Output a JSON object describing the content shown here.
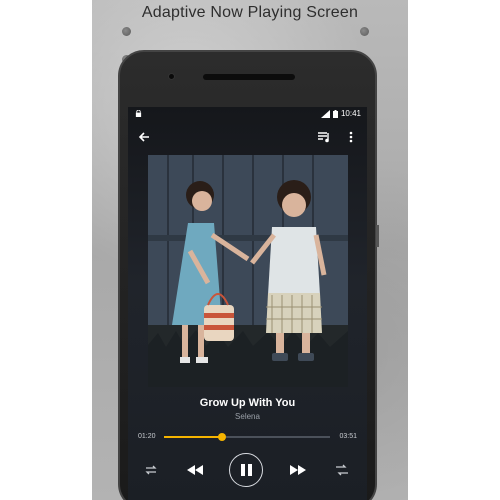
{
  "headline": "Adaptive Now Playing Screen",
  "status_bar": {
    "time": "10:41"
  },
  "icons": {
    "back": "arrow-back-icon",
    "queue": "queue-music-icon",
    "menu": "more-vert-icon",
    "repeat": "repeat-icon",
    "previous": "skip-previous-icon",
    "play_pause": "pause-icon",
    "next": "skip-next-icon",
    "shuffle": "shuffle-icon"
  },
  "now_playing": {
    "title": "Grow Up With You",
    "artist": "Selena",
    "elapsed": "01:20",
    "duration": "03:51",
    "progress": 0.35
  },
  "colors": {
    "accent": "#f5b400",
    "screen_bg": "#1b1f25",
    "text_primary": "#ffffff",
    "text_secondary": "#9aa0a8"
  }
}
